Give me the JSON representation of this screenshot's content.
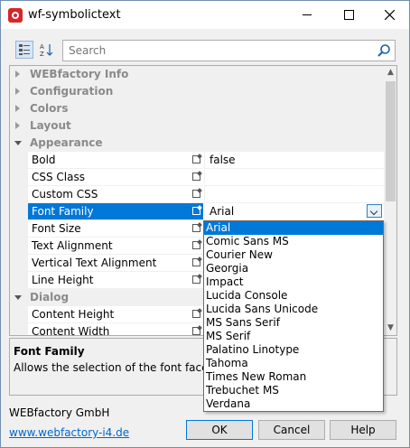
{
  "window": {
    "title": "wf-symbolictext"
  },
  "search": {
    "placeholder": "Search"
  },
  "grid": {
    "rows": [
      {
        "kind": "cat",
        "label": "WEBfactory Info",
        "open": false
      },
      {
        "kind": "cat",
        "label": "Configuration",
        "open": false
      },
      {
        "kind": "cat",
        "label": "Colors",
        "open": false
      },
      {
        "kind": "cat",
        "label": "Layout",
        "open": false
      },
      {
        "kind": "cat",
        "label": "Appearance",
        "open": true
      },
      {
        "kind": "prop",
        "label": "Bold",
        "value": "false"
      },
      {
        "kind": "prop",
        "label": "CSS Class",
        "value": ""
      },
      {
        "kind": "prop",
        "label": "Custom CSS",
        "value": ""
      },
      {
        "kind": "prop",
        "label": "Font Family",
        "value": "Arial",
        "selected": true
      },
      {
        "kind": "prop",
        "label": "Font Size",
        "value": ""
      },
      {
        "kind": "prop",
        "label": "Text Alignment",
        "value": ""
      },
      {
        "kind": "prop",
        "label": "Vertical Text Alignment",
        "value": ""
      },
      {
        "kind": "prop",
        "label": "Line Height",
        "value": ""
      },
      {
        "kind": "cat",
        "label": "Dialog",
        "open": true
      },
      {
        "kind": "prop",
        "label": "Content Height",
        "value": ""
      },
      {
        "kind": "prop",
        "label": "Content Width",
        "value": ""
      }
    ]
  },
  "dropdown": {
    "selected": "Arial",
    "options": [
      "Arial",
      "Comic Sans MS",
      "Courier New",
      "Georgia",
      "Impact",
      "Lucida Console",
      "Lucida Sans Unicode",
      "MS Sans Serif",
      "MS Serif",
      "Palatino Linotype",
      "Tahoma",
      "Times New Roman",
      "Trebuchet MS",
      "Verdana"
    ]
  },
  "help": {
    "title": "Font Family",
    "description": "Allows the selection of the font face."
  },
  "footer": {
    "company": "WEBfactory GmbH",
    "link": "www.webfactory-i4.de",
    "ok": "OK",
    "cancel": "Cancel",
    "help": "Help"
  },
  "colors": {
    "accent": "#0078d7",
    "brand": "#d7262a"
  }
}
